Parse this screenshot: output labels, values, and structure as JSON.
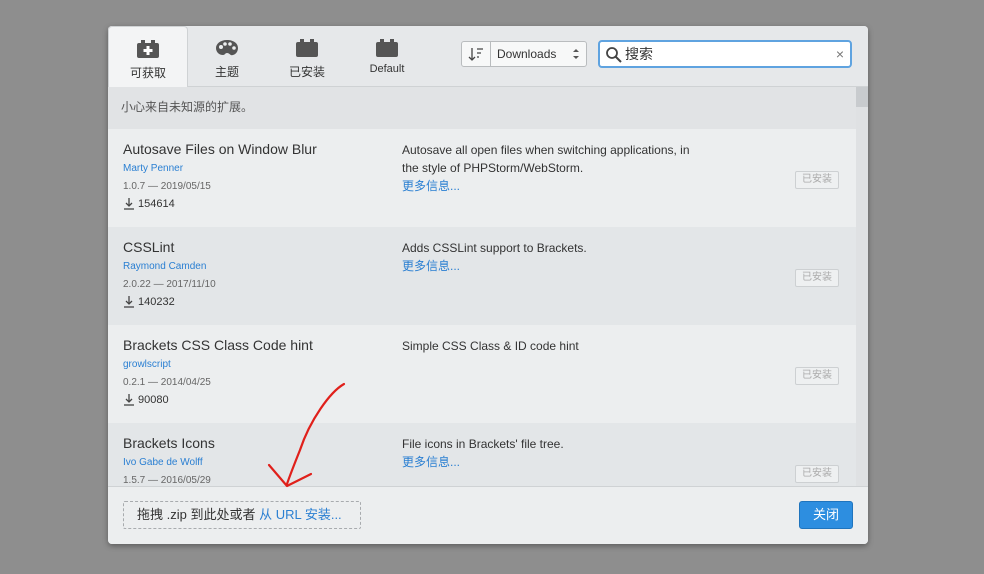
{
  "tabs": [
    {
      "label": "可获取",
      "icon": "plus-box-icon",
      "active": true
    },
    {
      "label": "主题",
      "icon": "palette-icon",
      "active": false
    },
    {
      "label": "已安装",
      "icon": "box-icon",
      "active": false
    },
    {
      "label": "Default",
      "icon": "box-icon",
      "active": false
    }
  ],
  "sort": {
    "value": "Downloads"
  },
  "search": {
    "value": "搜索",
    "placeholder": "搜索",
    "clear": "×"
  },
  "warning": "小心来自未知源的扩展。",
  "extensions": [
    {
      "name": "Autosave Files on Window Blur",
      "author": "Marty Penner",
      "version": "1.0.7 — 2019/05/15",
      "downloads": "154614",
      "description": "Autosave all open files when switching applications, in the style of PHPStorm/WebStorm.",
      "more": "更多信息...",
      "status": "已安装"
    },
    {
      "name": "CSSLint",
      "author": "Raymond Camden",
      "version": "2.0.22 — 2017/11/10",
      "downloads": "140232",
      "description": "Adds CSSLint support to Brackets.",
      "more": "更多信息...",
      "status": "已安装"
    },
    {
      "name": "Brackets CSS Class Code hint",
      "author": "growlscript",
      "version": "0.2.1 — 2014/04/25",
      "downloads": "90080",
      "description": "Simple CSS Class & ID code hint",
      "more": "",
      "status": "已安装"
    },
    {
      "name": "Brackets Icons",
      "author": "Ivo Gabe de Wolff",
      "version": "1.5.7 — 2016/05/29",
      "downloads": "",
      "description": "File icons in Brackets' file tree.",
      "more": "更多信息...",
      "status": "已安装"
    }
  ],
  "footer": {
    "drop_text": "拖拽 .zip 到此处或者 ",
    "url_link": "从 URL 安装...",
    "close_label": "关闭"
  },
  "colors": {
    "accent": "#2d8ee0",
    "link": "#2a7fd2",
    "annotation": "#e0201b"
  }
}
